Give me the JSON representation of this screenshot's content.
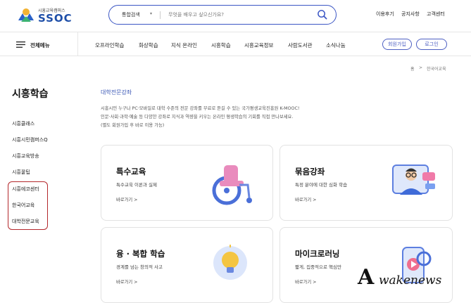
{
  "header": {
    "logo_sub": "시흥교육캠퍼스",
    "logo_main": "SSOC",
    "search_category": "통합검색",
    "search_placeholder": "무엇을 배우고 싶으신가요?",
    "util_links": [
      "이용후기",
      "공지사항",
      "고객센터"
    ]
  },
  "nav": {
    "menu_label": "전체메뉴",
    "items": [
      "오프라인학습",
      "화상학습",
      "지식 온라인",
      "시흥학습",
      "시흥교육정보",
      "사람도서관",
      "소식나눔"
    ],
    "signup": "회원가입",
    "login": "로그인"
  },
  "breadcrumb": {
    "home": "홈",
    "sep": ">",
    "current": "한국어교육"
  },
  "sidebar": {
    "title": "시흥학습",
    "items": [
      "시흥클래스",
      "시흥시민캠퍼스Q",
      "시흥교육방송",
      "시흥꿀팁",
      "시흥에코센터",
      "한국어교육",
      "대학전문교육"
    ]
  },
  "main": {
    "section_title": "대학전문강좌",
    "desc": [
      "시흥시민 누구나 PC·모바일로 대학 수준의 전문 강좌를 무료로 듣길 수 있는 국가평생교육진흥원 K-MOOC!",
      "인문·사회·과학·예술 등 다양한 강좌로 지식과 역량을 키우는 온라인 평생학습의 기회를 직접 만나보세요.",
      "(별도 회원가입 후 바로 이용 가능)"
    ],
    "cards": [
      {
        "title": "특수교육",
        "subtitle": "특수교육 이론과 실제",
        "link": "바로가기 >",
        "icon": "wheelchair-icon"
      },
      {
        "title": "묶음강좌",
        "subtitle": "특정 분야에 대한 심화 학습",
        "link": "바로가기 >",
        "icon": "online-lecture-icon"
      },
      {
        "title": "융 · 복합 학습",
        "subtitle": "경계를 넘는 창의적 사고",
        "link": "바로가기 >",
        "icon": "lightbulb-icon"
      },
      {
        "title": "마이크로러닝",
        "subtitle": "짧게, 집중적으로 핵심만",
        "link": "바로가기 >",
        "icon": "mobile-video-icon"
      }
    ]
  },
  "watermark": {
    "letter": "A",
    "text": "wakenews"
  },
  "colors": {
    "accent": "#3b56c4",
    "highlight_box": "#b4282c",
    "section_title": "#3a57b5"
  }
}
